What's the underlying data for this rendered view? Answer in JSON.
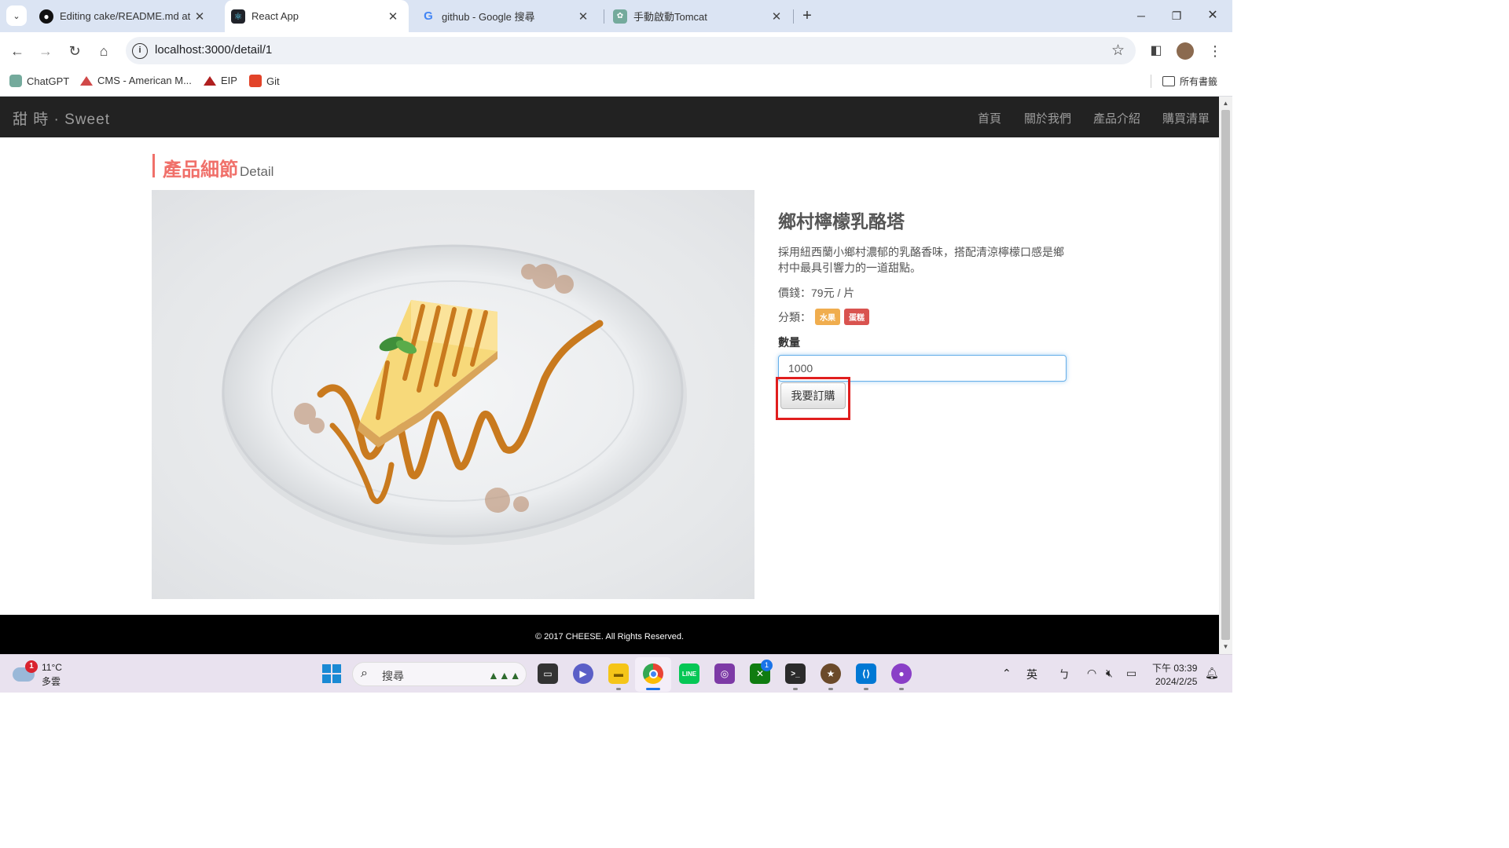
{
  "browser": {
    "tabs": [
      {
        "title": "Editing cake/README.md at r",
        "icon": "github-icon",
        "active": false
      },
      {
        "title": "React App",
        "icon": "react-icon",
        "active": true
      },
      {
        "title": "github - Google 搜尋",
        "icon": "google-icon",
        "active": false
      },
      {
        "title": "手動啟動Tomcat",
        "icon": "chatgpt-icon",
        "active": false
      }
    ],
    "url": "localhost:3000/detail/1",
    "bookmarks": [
      {
        "label": "ChatGPT",
        "icon": "chatgpt-icon"
      },
      {
        "label": "CMS - American M...",
        "icon": "cms-icon"
      },
      {
        "label": "EIP",
        "icon": "eip-icon"
      },
      {
        "label": "Git",
        "icon": "gitlab-icon"
      }
    ],
    "all_bookmarks": "所有書籤"
  },
  "site": {
    "brand": "甜 時 · Sweet",
    "nav": [
      "首頁",
      "關於我們",
      "產品介紹",
      "購買清單"
    ],
    "heading_zh": "產品細節",
    "heading_en": "Detail",
    "product": {
      "name": "鄉村檸檬乳酪塔",
      "description": "採用紐西蘭小鄉村濃郁的乳酪香味，搭配清涼檸檬口感是鄉村中最具引響力的一道甜點。",
      "price": "價錢：79元 / 片",
      "category_label": "分類：",
      "categories": [
        {
          "label": "水果",
          "color": "#f0ad4e"
        },
        {
          "label": "蛋糕",
          "color": "#d9534f"
        }
      ],
      "quantity_label": "數量",
      "quantity_value": "1000",
      "order_button": "我要訂購"
    },
    "footer": "© 2017 CHEESE. All Rights Reserved."
  },
  "taskbar": {
    "weather_temp": "11°C",
    "weather_desc": "多雲",
    "weather_badge": "1",
    "search_placeholder": "搜尋",
    "ime_lang": "英",
    "ime_mode": "ㄅ",
    "time": "下午 03:39",
    "date": "2024/2/25",
    "xbox_badge": "1"
  },
  "colors": {
    "accent": "#f0706a",
    "navbar": "#222222",
    "highlight_box": "#e01e1e"
  }
}
